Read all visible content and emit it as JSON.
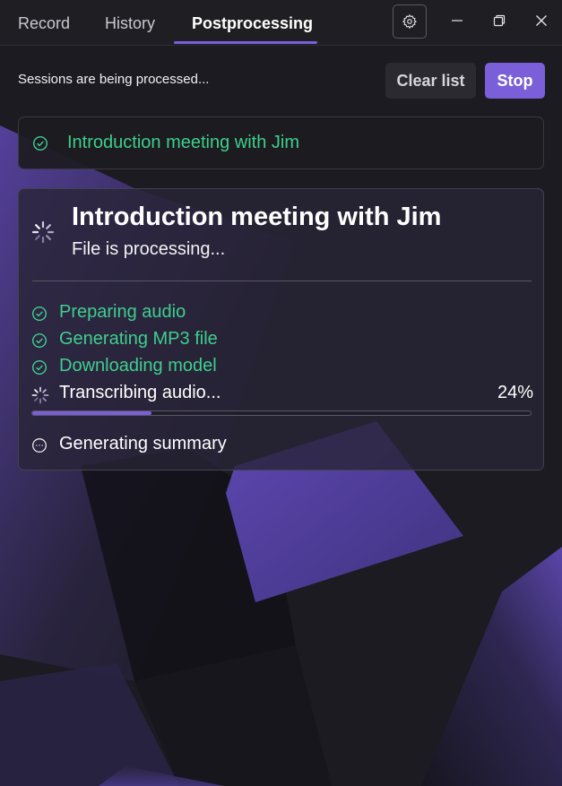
{
  "tabs": [
    {
      "label": "Record"
    },
    {
      "label": "History"
    },
    {
      "label": "Postprocessing"
    }
  ],
  "active_tab": "Postprocessing",
  "status": {
    "text": "Sessions are being processed..."
  },
  "actions": {
    "clear_label": "Clear list",
    "stop_label": "Stop"
  },
  "sessions": [
    {
      "title": "Introduction meeting with Jim",
      "state": "completed",
      "expanded": false
    },
    {
      "title": "Introduction meeting with Jim",
      "subtitle": "File is processing...",
      "state": "processing",
      "expanded": true,
      "steps": [
        {
          "label": "Preparing audio",
          "state": "done"
        },
        {
          "label": "Generating MP3 file",
          "state": "done"
        },
        {
          "label": "Downloading model",
          "state": "done"
        },
        {
          "label": "Transcribing audio...",
          "state": "in-progress",
          "progress_text": "24%",
          "progress": 0.24
        },
        {
          "label": "Generating summary",
          "state": "pending"
        }
      ]
    }
  ],
  "icons": {
    "settings": "gear-icon",
    "minimize": "minimize-icon",
    "restore": "restore-icon",
    "close": "close-icon",
    "done": "check-circle-icon",
    "in_progress": "spinner-icon",
    "pending": "pending-circle-icon"
  },
  "colors": {
    "accent": "#7a5fd9",
    "success": "#3ecf8e",
    "background": "#1c1b21"
  }
}
